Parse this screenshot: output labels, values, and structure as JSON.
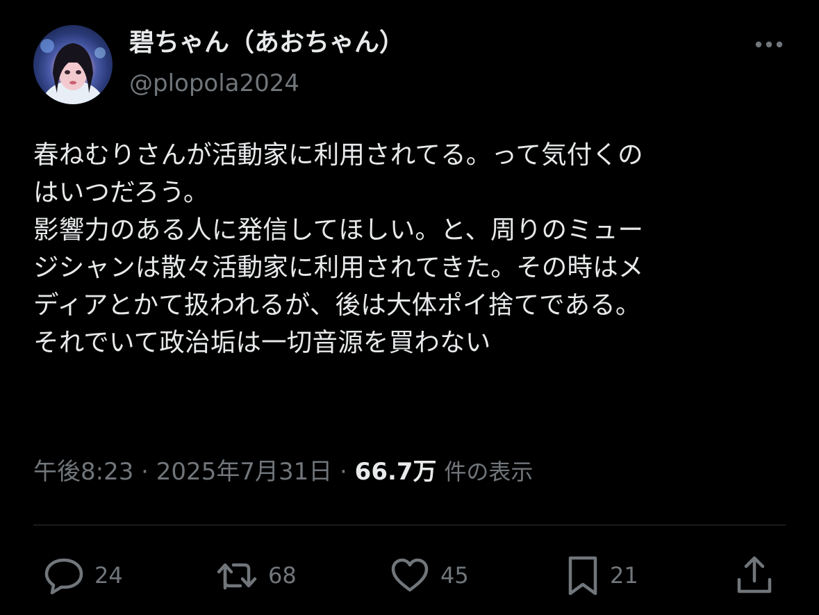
{
  "author": {
    "display_name": "碧ちゃん（あおちゃん）",
    "handle": "@plopola2024"
  },
  "tweet": {
    "text": "春ねむりさんが活動家に利用されてる。って気付くの\nはいつだろう。\n影響力のある人に発信してほしい。と、周りのミュー\nジシャンは散々活動家に利用されてきた。その時はメ\nディアとかて扱われるが、後は大体ポイ捨てである。\nそれでいて政治垢は一切音源を買わない",
    "time": "午後8:23",
    "date": "2025年7月31日",
    "separator": "·",
    "views_count": "66.7万",
    "views_label": "件の表示"
  },
  "actions": {
    "reply_count": "24",
    "retweet_count": "68",
    "like_count": "45",
    "bookmark_count": "21"
  },
  "icons": {
    "more": "more-horizontal-icon",
    "reply": "speech-bubble-icon",
    "retweet": "retweet-arrows-icon",
    "like": "heart-icon",
    "bookmark": "bookmark-icon",
    "share": "share-upload-icon"
  },
  "colors": {
    "background": "#000000",
    "primary_text": "#e7e9ea",
    "secondary_text": "#71767b",
    "divider": "#2f3336"
  }
}
